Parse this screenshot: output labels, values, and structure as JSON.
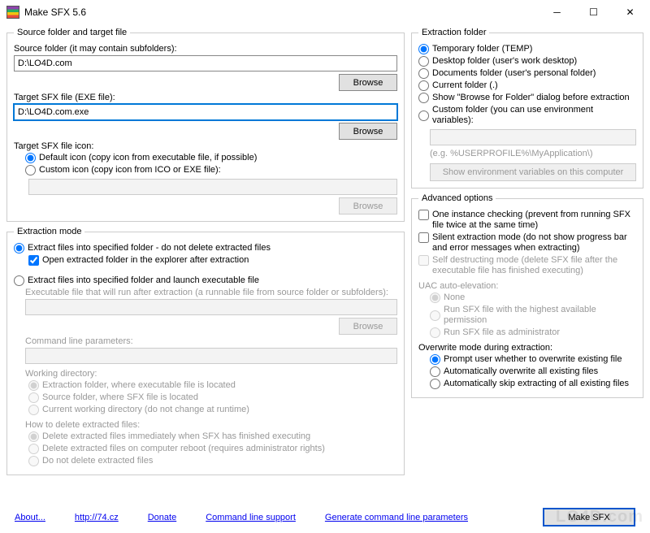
{
  "title": "Make SFX 5.6",
  "source": {
    "legend": "Source folder and target file",
    "source_label": "Source folder (it may contain subfolders):",
    "source_value": "D:\\LO4D.com",
    "browse": "Browse",
    "target_label": "Target SFX file (EXE file):",
    "target_value": "D:\\LO4D.com.exe",
    "icon_label": "Target SFX file icon:",
    "icon_default": "Default icon (copy icon from executable file, if possible)",
    "icon_custom": "Custom icon (copy icon from ICO or EXE file):"
  },
  "ex_mode": {
    "legend": "Extraction mode",
    "opt1": "Extract files into specified folder - do not delete extracted files",
    "opt1_sub": "Open extracted folder in the explorer after extraction",
    "opt2": "Extract files into specified folder and launch executable file",
    "exe_label": "Executable file that will run after extraction (a runnable file from source folder or subfolders):",
    "cmd_label": "Command line parameters:",
    "wd_label": "Working directory:",
    "wd1": "Extraction folder, where executable file is located",
    "wd2": "Source folder, where SFX file is located",
    "wd3": "Current working directory (do not change at runtime)",
    "del_label": "How to delete extracted files:",
    "del1": "Delete extracted files immediately when SFX has finished executing",
    "del2": "Delete extracted files on computer reboot (requires administrator rights)",
    "del3": "Do not delete extracted files"
  },
  "ex_folder": {
    "legend": "Extraction folder",
    "f1": "Temporary folder (TEMP)",
    "f2": "Desktop folder (user's work desktop)",
    "f3": "Documents folder (user's personal folder)",
    "f4": "Current folder (.)",
    "f5": "Show \"Browse for Folder\" dialog before extraction",
    "f6": "Custom folder (you can use environment variables):",
    "ph": "(e.g. %USERPROFILE%\\MyApplication\\)",
    "env_btn": "Show environment variables on this computer"
  },
  "adv": {
    "legend": "Advanced options",
    "c1": "One instance checking (prevent from running SFX file twice at the same time)",
    "c2": "Silent extraction mode (do not show progress bar and error messages when extracting)",
    "c3": "Self destructing mode (delete SFX file after the executable file has finished executing)",
    "uac_label": "UAC auto-elevation:",
    "u1": "None",
    "u2": "Run SFX file with the highest available permission",
    "u3": "Run SFX file as administrator",
    "ow_label": "Overwrite mode during extraction:",
    "o1": "Prompt user whether to overwrite existing file",
    "o2": "Automatically overwrite all existing files",
    "o3": "Automatically skip extracting of all existing files"
  },
  "links": {
    "about": "About...",
    "site": "http://74.cz",
    "donate": "Donate",
    "cli": "Command line support",
    "gen": "Generate command line parameters"
  },
  "make_btn": "Make SFX",
  "watermark": "LO4D.com"
}
